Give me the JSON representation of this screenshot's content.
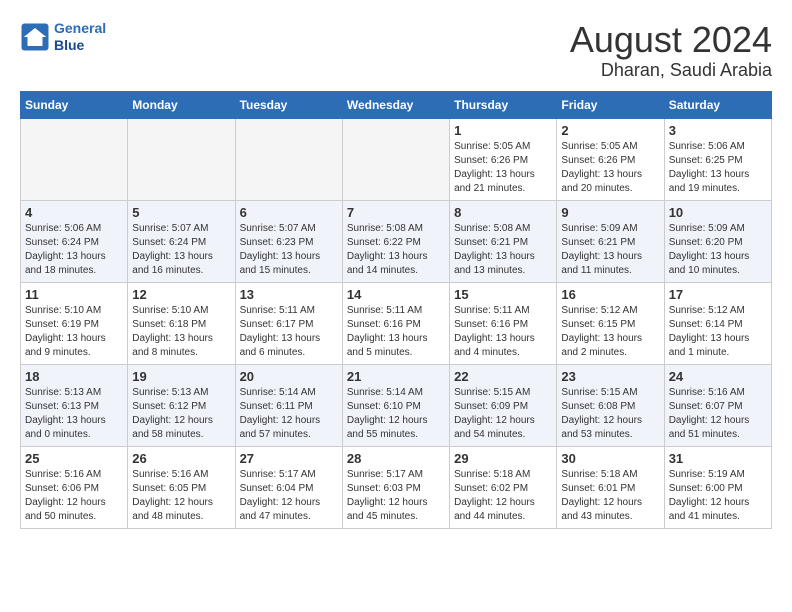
{
  "header": {
    "logo_line1": "General",
    "logo_line2": "Blue",
    "main_title": "August 2024",
    "subtitle": "Dharan, Saudi Arabia"
  },
  "calendar": {
    "days_of_week": [
      "Sunday",
      "Monday",
      "Tuesday",
      "Wednesday",
      "Thursday",
      "Friday",
      "Saturday"
    ],
    "weeks": [
      [
        {
          "day": "",
          "info": ""
        },
        {
          "day": "",
          "info": ""
        },
        {
          "day": "",
          "info": ""
        },
        {
          "day": "",
          "info": ""
        },
        {
          "day": "1",
          "info": "Sunrise: 5:05 AM\nSunset: 6:26 PM\nDaylight: 13 hours\nand 21 minutes."
        },
        {
          "day": "2",
          "info": "Sunrise: 5:05 AM\nSunset: 6:26 PM\nDaylight: 13 hours\nand 20 minutes."
        },
        {
          "day": "3",
          "info": "Sunrise: 5:06 AM\nSunset: 6:25 PM\nDaylight: 13 hours\nand 19 minutes."
        }
      ],
      [
        {
          "day": "4",
          "info": "Sunrise: 5:06 AM\nSunset: 6:24 PM\nDaylight: 13 hours\nand 18 minutes."
        },
        {
          "day": "5",
          "info": "Sunrise: 5:07 AM\nSunset: 6:24 PM\nDaylight: 13 hours\nand 16 minutes."
        },
        {
          "day": "6",
          "info": "Sunrise: 5:07 AM\nSunset: 6:23 PM\nDaylight: 13 hours\nand 15 minutes."
        },
        {
          "day": "7",
          "info": "Sunrise: 5:08 AM\nSunset: 6:22 PM\nDaylight: 13 hours\nand 14 minutes."
        },
        {
          "day": "8",
          "info": "Sunrise: 5:08 AM\nSunset: 6:21 PM\nDaylight: 13 hours\nand 13 minutes."
        },
        {
          "day": "9",
          "info": "Sunrise: 5:09 AM\nSunset: 6:21 PM\nDaylight: 13 hours\nand 11 minutes."
        },
        {
          "day": "10",
          "info": "Sunrise: 5:09 AM\nSunset: 6:20 PM\nDaylight: 13 hours\nand 10 minutes."
        }
      ],
      [
        {
          "day": "11",
          "info": "Sunrise: 5:10 AM\nSunset: 6:19 PM\nDaylight: 13 hours\nand 9 minutes."
        },
        {
          "day": "12",
          "info": "Sunrise: 5:10 AM\nSunset: 6:18 PM\nDaylight: 13 hours\nand 8 minutes."
        },
        {
          "day": "13",
          "info": "Sunrise: 5:11 AM\nSunset: 6:17 PM\nDaylight: 13 hours\nand 6 minutes."
        },
        {
          "day": "14",
          "info": "Sunrise: 5:11 AM\nSunset: 6:16 PM\nDaylight: 13 hours\nand 5 minutes."
        },
        {
          "day": "15",
          "info": "Sunrise: 5:11 AM\nSunset: 6:16 PM\nDaylight: 13 hours\nand 4 minutes."
        },
        {
          "day": "16",
          "info": "Sunrise: 5:12 AM\nSunset: 6:15 PM\nDaylight: 13 hours\nand 2 minutes."
        },
        {
          "day": "17",
          "info": "Sunrise: 5:12 AM\nSunset: 6:14 PM\nDaylight: 13 hours\nand 1 minute."
        }
      ],
      [
        {
          "day": "18",
          "info": "Sunrise: 5:13 AM\nSunset: 6:13 PM\nDaylight: 13 hours\nand 0 minutes."
        },
        {
          "day": "19",
          "info": "Sunrise: 5:13 AM\nSunset: 6:12 PM\nDaylight: 12 hours\nand 58 minutes."
        },
        {
          "day": "20",
          "info": "Sunrise: 5:14 AM\nSunset: 6:11 PM\nDaylight: 12 hours\nand 57 minutes."
        },
        {
          "day": "21",
          "info": "Sunrise: 5:14 AM\nSunset: 6:10 PM\nDaylight: 12 hours\nand 55 minutes."
        },
        {
          "day": "22",
          "info": "Sunrise: 5:15 AM\nSunset: 6:09 PM\nDaylight: 12 hours\nand 54 minutes."
        },
        {
          "day": "23",
          "info": "Sunrise: 5:15 AM\nSunset: 6:08 PM\nDaylight: 12 hours\nand 53 minutes."
        },
        {
          "day": "24",
          "info": "Sunrise: 5:16 AM\nSunset: 6:07 PM\nDaylight: 12 hours\nand 51 minutes."
        }
      ],
      [
        {
          "day": "25",
          "info": "Sunrise: 5:16 AM\nSunset: 6:06 PM\nDaylight: 12 hours\nand 50 minutes."
        },
        {
          "day": "26",
          "info": "Sunrise: 5:16 AM\nSunset: 6:05 PM\nDaylight: 12 hours\nand 48 minutes."
        },
        {
          "day": "27",
          "info": "Sunrise: 5:17 AM\nSunset: 6:04 PM\nDaylight: 12 hours\nand 47 minutes."
        },
        {
          "day": "28",
          "info": "Sunrise: 5:17 AM\nSunset: 6:03 PM\nDaylight: 12 hours\nand 45 minutes."
        },
        {
          "day": "29",
          "info": "Sunrise: 5:18 AM\nSunset: 6:02 PM\nDaylight: 12 hours\nand 44 minutes."
        },
        {
          "day": "30",
          "info": "Sunrise: 5:18 AM\nSunset: 6:01 PM\nDaylight: 12 hours\nand 43 minutes."
        },
        {
          "day": "31",
          "info": "Sunrise: 5:19 AM\nSunset: 6:00 PM\nDaylight: 12 hours\nand 41 minutes."
        }
      ]
    ]
  }
}
